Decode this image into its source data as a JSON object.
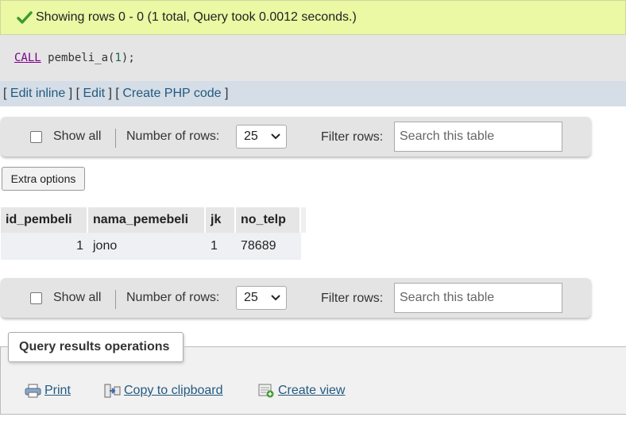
{
  "message": {
    "text": "Showing rows 0 - 0 (1 total, Query took 0.0012 seconds.)",
    "icon": "check-icon"
  },
  "sql": {
    "keyword": "CALL",
    "proc": "pembeli_a",
    "open": "(",
    "arg": "1",
    "close": ");"
  },
  "query_links": {
    "edit_inline": "Edit inline",
    "edit": "Edit",
    "create_php": "Create PHP code"
  },
  "nav_top": {
    "show_all": "Show all",
    "num_rows_label": "Number of rows:",
    "num_rows_value": "25",
    "filter_label": "Filter rows:",
    "filter_placeholder": "Search this table"
  },
  "nav_bottom": {
    "show_all": "Show all",
    "num_rows_label": "Number of rows:",
    "num_rows_value": "25",
    "filter_label": "Filter rows:",
    "filter_placeholder": "Search this table"
  },
  "extra_options": "Extra options",
  "table": {
    "columns": [
      "id_pembeli",
      "nama_pemebeli",
      "jk",
      "no_telp"
    ],
    "rows": [
      [
        "1",
        "jono",
        "1",
        "78689"
      ]
    ]
  },
  "operations": {
    "legend": "Query results operations",
    "print": "Print",
    "copy": "Copy to clipboard",
    "create_view": "Create view"
  },
  "colors": {
    "success_bg": "#ebf8a4",
    "link": "#235a81",
    "check": "#3c9a2e"
  }
}
